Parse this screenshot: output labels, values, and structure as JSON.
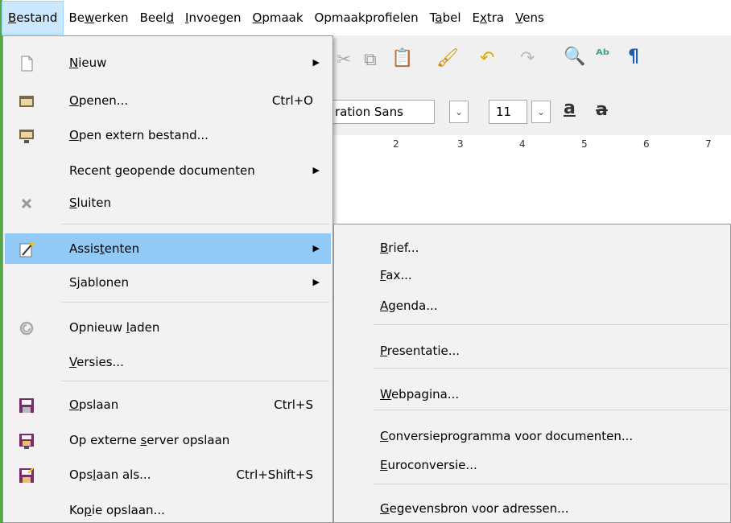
{
  "menubar": [
    {
      "label": "Bestand",
      "accel": "B",
      "active": true
    },
    {
      "label": "Bewerken",
      "accel": "w"
    },
    {
      "label": "Beeld",
      "accel": "d"
    },
    {
      "label": "Invoegen",
      "accel": "I"
    },
    {
      "label": "Opmaak",
      "accel": "O"
    },
    {
      "label": "Opmaakprofielen",
      "accel": "i"
    },
    {
      "label": "Tabel",
      "accel": "a"
    },
    {
      "label": "Extra",
      "accel": "x"
    },
    {
      "label": "Vens",
      "accel": "V"
    }
  ],
  "toolbar": {
    "font_name": "ration Sans",
    "font_size": "11",
    "ruler_numbers": [
      "2",
      "3",
      "4",
      "5",
      "6",
      "7"
    ]
  },
  "file_menu": {
    "items": [
      {
        "label": "Nieuw",
        "accel": "N",
        "icon": "new-document-icon",
        "submenu": true
      },
      {
        "label": "Openen...",
        "accel": "O",
        "icon": "folder-open-icon",
        "shortcut": "Ctrl+O"
      },
      {
        "label": "Open extern bestand...",
        "accel": "O",
        "icon": "remote-folder-icon"
      },
      {
        "label": "Recent geopende documenten",
        "accel": "g",
        "submenu": true
      },
      {
        "label": "Sluiten",
        "accel": "S",
        "icon": "close-icon"
      },
      {
        "label": "Assistenten",
        "accel": "t",
        "icon": "wizard-icon",
        "submenu": true,
        "highlighted": true
      },
      {
        "label": "Sjablonen",
        "accel": "j",
        "submenu": true
      },
      {
        "label": "Opnieuw laden",
        "accel": "l",
        "icon": "reload-icon"
      },
      {
        "label": "Versies...",
        "accel": "V"
      },
      {
        "label": "Opslaan",
        "accel": "O",
        "icon": "save-icon",
        "shortcut": "Ctrl+S"
      },
      {
        "label": "Op externe server opslaan",
        "accel": "s",
        "icon": "save-remote-icon"
      },
      {
        "label": "Opslaan als...",
        "accel": "l",
        "icon": "save-as-icon",
        "shortcut": "Ctrl+Shift+S"
      },
      {
        "label": "Kopie opslaan...",
        "accel": "p"
      }
    ]
  },
  "wizards_submenu": {
    "items": [
      {
        "label": "Brief...",
        "accel": "B"
      },
      {
        "label": "Fax...",
        "accel": "F"
      },
      {
        "label": "Agenda...",
        "accel": "A"
      },
      {
        "label": "Presentatie...",
        "accel": "P"
      },
      {
        "label": "Webpagina...",
        "accel": "W"
      },
      {
        "label": "Conversieprogramma voor documenten...",
        "accel": "C"
      },
      {
        "label": "Euroconversie...",
        "accel": "E"
      },
      {
        "label": "Gegevensbron voor adressen...",
        "accel": "G"
      }
    ]
  },
  "colors": {
    "highlight": "#91c9f7",
    "menu_bg": "#f2f2f2",
    "window_border": "#57a64a"
  }
}
